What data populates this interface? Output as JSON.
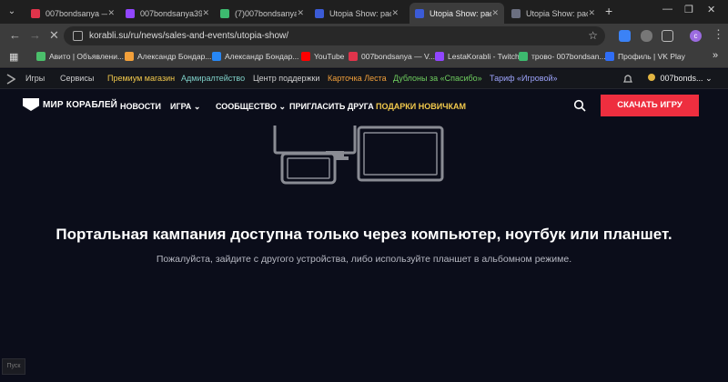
{
  "browser": {
    "tabs": [
      {
        "title": "007bondsanya — \\",
        "color": "#e0344b"
      },
      {
        "title": "007bondsanya39",
        "color": "#9146ff"
      },
      {
        "title": "(7)007bondsanya3",
        "color": "#3dba6f"
      },
      {
        "title": "Utopia Show: расс",
        "color": "#3b5bd6"
      },
      {
        "title": "Utopia Show: расс",
        "color": "#3b5bd6"
      },
      {
        "title": "Utopia Show: расс",
        "color": "#6b6f80"
      }
    ],
    "active_tab": 4,
    "address": "korabli.su/ru/news/sales-and-events/utopia-show/",
    "profile_initial": "c",
    "bookmarks": [
      {
        "label": "Авито | Объявлени...",
        "color": "#4bbf6b"
      },
      {
        "label": "Александр Бондар...",
        "color": "#f2a03a"
      },
      {
        "label": "Александр Бондар...",
        "color": "#2787f5"
      },
      {
        "label": "YouTube",
        "color": "#ff0000"
      },
      {
        "label": "007bondsanya — V...",
        "color": "#e0344b"
      },
      {
        "label": "LestaKorabli - Twitch",
        "color": "#9146ff"
      },
      {
        "label": "трово- 007bondsan...",
        "color": "#3dba6f"
      },
      {
        "label": "Профиль | VK Play",
        "color": "#2f6df6"
      }
    ]
  },
  "site": {
    "top_links": [
      {
        "label": "Игры",
        "color": "#cfcfcf"
      },
      {
        "label": "Сервисы",
        "color": "#cfcfcf"
      },
      {
        "label": "Премиум магазин",
        "color": "#f2c94c"
      },
      {
        "label": "Адмиралтейство",
        "color": "#7fd0c8"
      },
      {
        "label": "Центр поддержки",
        "color": "#cfcfcf"
      },
      {
        "label": "Карточка Леста",
        "color": "#f2a03a"
      },
      {
        "label": "Дублоны за «Спасибо»",
        "color": "#6fcf5f"
      },
      {
        "label": "Тариф «Игровой»",
        "color": "#9fa6ff"
      }
    ],
    "account": "007bonds...",
    "logo": "МИР КОРАБЛЕЙ",
    "nav": [
      "НОВОСТИ",
      "ИГРА",
      "СООБЩЕСТВО",
      "ПРИГЛАСИТЬ ДРУГА",
      "ПОДАРКИ НОВИЧКАМ"
    ],
    "cta": "СКАЧАТЬ ИГРУ",
    "headline": "Портальная кампания доступна только через компьютер, ноутбук или планшет.",
    "subline": "Пожалуйста, зайдите с другого устройства, либо используйте планшет в альбомном режиме."
  },
  "taskbar": {
    "start_label": "Пуск"
  }
}
